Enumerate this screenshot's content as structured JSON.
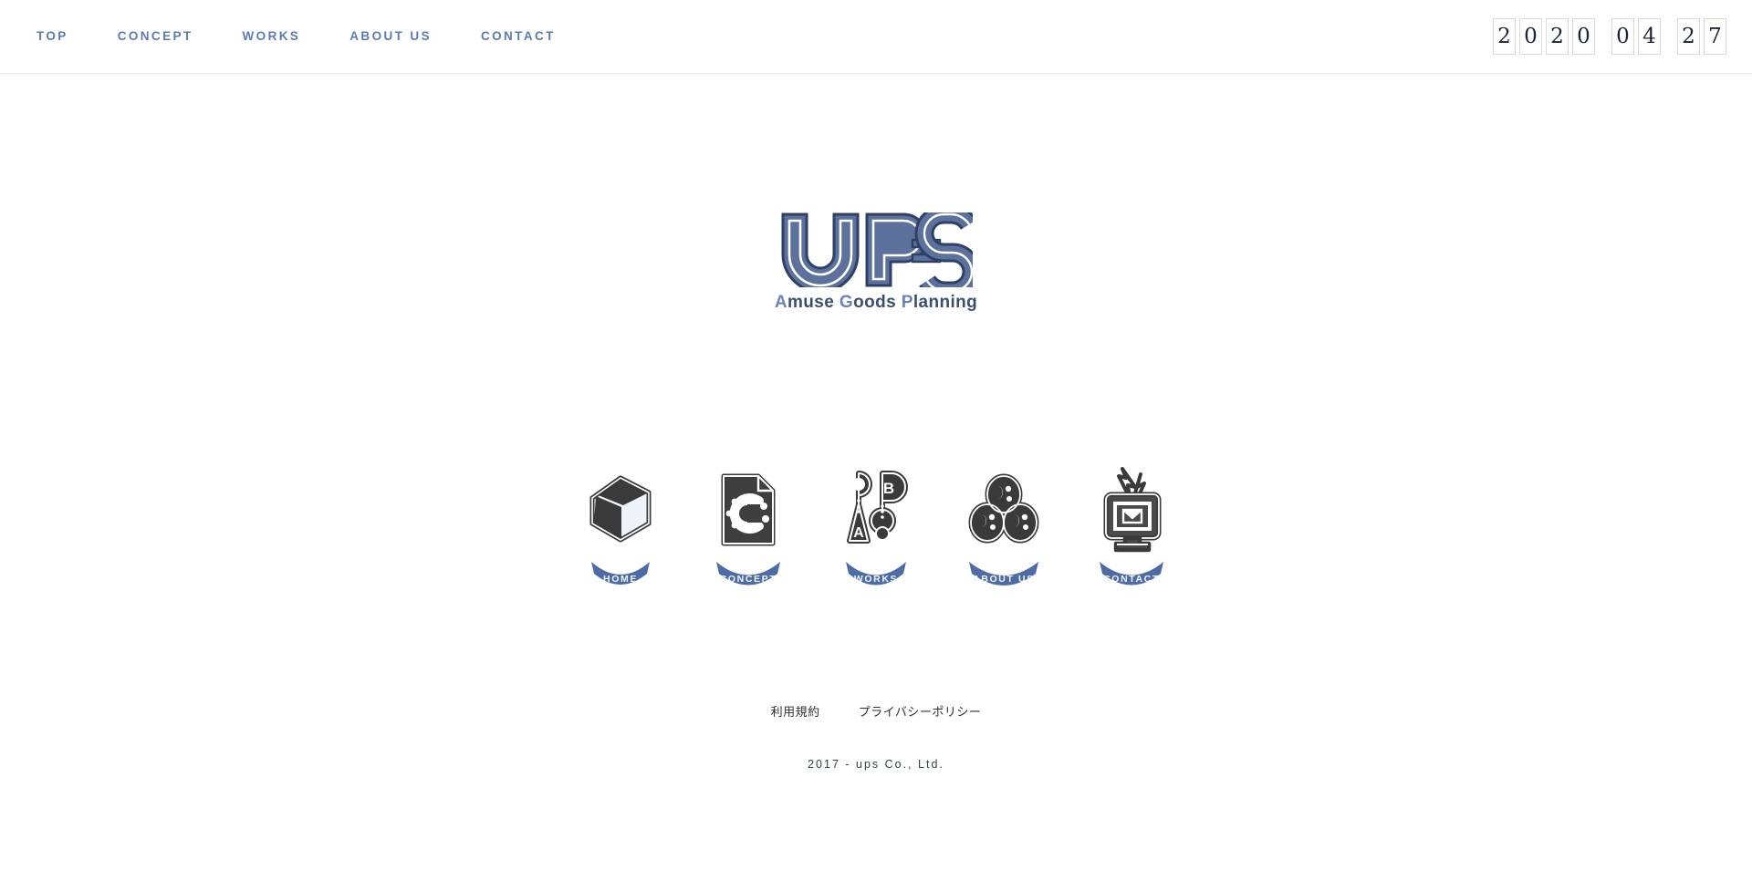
{
  "header": {
    "nav": [
      {
        "label": "TOP",
        "name": "nav-item-top"
      },
      {
        "label": "CONCEPT",
        "name": "nav-item-concept"
      },
      {
        "label": "WORKS",
        "name": "nav-item-works"
      },
      {
        "label": "ABOUT US",
        "name": "nav-item-about-us"
      },
      {
        "label": "CONTACT",
        "name": "nav-item-contact"
      }
    ],
    "date_counter": {
      "year": [
        "2",
        "0",
        "2",
        "0"
      ],
      "month": [
        "0",
        "4"
      ],
      "day": [
        "2",
        "7"
      ]
    }
  },
  "logo": {
    "mark_text": "UP=S",
    "tagline_a": "A",
    "tagline_1": "muse ",
    "tagline_g": "G",
    "tagline_2": "oods ",
    "tagline_p": "P",
    "tagline_3": "lanning",
    "tagline_full": "Amuse Goods Planning"
  },
  "icon_nav": [
    {
      "label": "HOME",
      "icon": "isometric-house-icon",
      "ribbon_width": 62
    },
    {
      "label": "CONCEPT",
      "icon": "document-c-gear-icon",
      "ribbon_width": 70
    },
    {
      "label": "WORKS",
      "icon": "letters-ab-icon",
      "ribbon_width": 66
    },
    {
      "label": "ABOUT US",
      "icon": "three-faces-icon",
      "ribbon_width": 74
    },
    {
      "label": "CONTACT",
      "icon": "monitor-envelope-icon",
      "ribbon_width": 70
    }
  ],
  "footer": {
    "terms_label": "利用規約",
    "privacy_label": "プライバシーポリシー",
    "copyright": "2017 - ups Co., Ltd."
  },
  "colors": {
    "nav_blue": "#5b7ab5",
    "logo_dark": "#3b4f73",
    "logo_light": "#6b84b8",
    "ribbon_blue": "#4d6ca5",
    "icon_dark": "#3a3a3a"
  }
}
